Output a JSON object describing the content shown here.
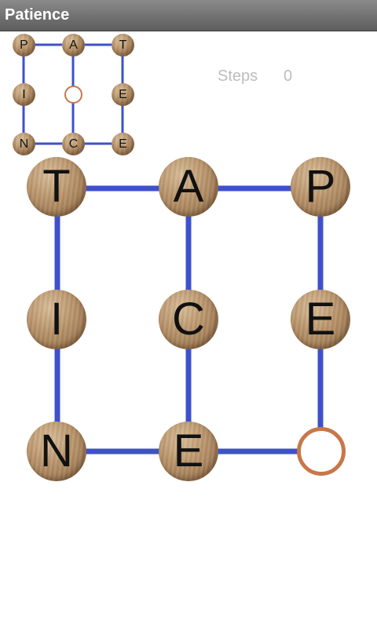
{
  "app": {
    "title": "Patience"
  },
  "stats": {
    "steps_label": "Steps",
    "steps_value": "0"
  },
  "colors": {
    "edge": "#3f51c9",
    "empty_ring": "#c7774a",
    "titlebar": "#6f6f6f"
  },
  "target_grid": [
    [
      "P",
      "A",
      "T"
    ],
    [
      "I",
      "",
      "E"
    ],
    [
      "N",
      "C",
      "E"
    ]
  ],
  "board_grid": [
    [
      "T",
      "A",
      "P"
    ],
    [
      "I",
      "C",
      "E"
    ],
    [
      "N",
      "E",
      ""
    ]
  ]
}
